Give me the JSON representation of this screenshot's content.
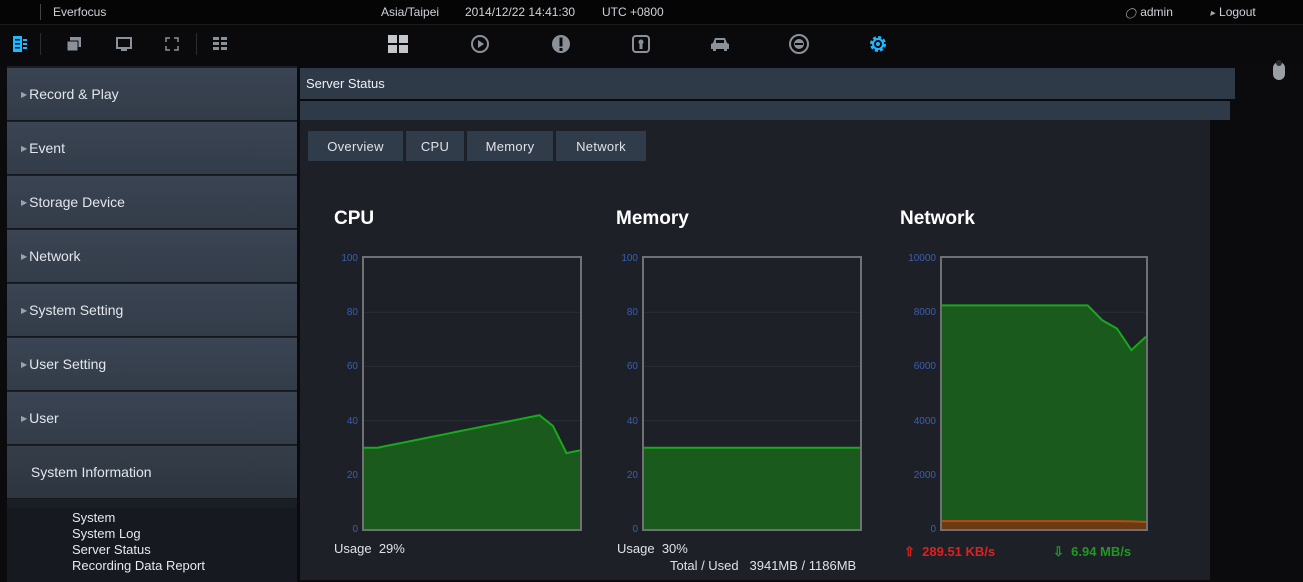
{
  "topbar": {
    "app_name": "Everfocus",
    "timezone": "Asia/Taipei",
    "datetime": "2014/12/22 14:41:30",
    "utc_offset": "UTC +0800",
    "user": "admin",
    "logout_label": "Logout"
  },
  "toolbar": {
    "icons": [
      "live-view-icon",
      "window-icon",
      "monitor-icon",
      "fullscreen-icon",
      "layout-icon",
      "grid-icon",
      "playback-icon",
      "alert-icon",
      "id-card-icon",
      "vehicle-icon",
      "target-icon",
      "settings-icon"
    ],
    "active_color": "#1fb8ff",
    "accent_color": "#1fb8ff"
  },
  "sidebar": {
    "items": [
      {
        "label": "Record & Play"
      },
      {
        "label": "Event"
      },
      {
        "label": "Storage Device"
      },
      {
        "label": "Network"
      },
      {
        "label": "System Setting"
      },
      {
        "label": "User Setting"
      },
      {
        "label": "User"
      },
      {
        "label": "System Information"
      }
    ],
    "submenu": [
      {
        "label": "System"
      },
      {
        "label": "System Log"
      },
      {
        "label": "Server Status"
      },
      {
        "label": "Recording Data Report"
      }
    ]
  },
  "main": {
    "title": "Server Status",
    "tabs": [
      {
        "label": "Overview"
      },
      {
        "label": "CPU"
      },
      {
        "label": "Memory"
      },
      {
        "label": "Network"
      }
    ]
  },
  "chart_data": [
    {
      "type": "area",
      "title": "CPU",
      "ylim": [
        0,
        100
      ],
      "yticks": [
        "100",
        "80",
        "60",
        "40",
        "20",
        "0"
      ],
      "x": [
        0,
        1,
        2,
        3,
        4,
        5,
        6,
        7,
        8,
        9,
        10,
        11,
        12,
        13
      ],
      "series": [
        {
          "values": [
            30,
            30,
            31,
            32,
            33,
            34,
            35,
            36,
            37,
            38,
            39,
            40,
            41,
            42
          ]
        }
      ],
      "tail_values": [
        38,
        28,
        29
      ],
      "usage_label": "Usage",
      "usage_value": "29%",
      "fill_color": "#1a5a1c",
      "line_color": "#1aa81c"
    },
    {
      "type": "area",
      "title": "Memory",
      "ylim": [
        0,
        100
      ],
      "yticks": [
        "100",
        "80",
        "60",
        "40",
        "20",
        "0"
      ],
      "x": [
        0,
        1,
        2,
        3,
        4,
        5,
        6,
        7,
        8,
        9,
        10,
        11,
        12,
        13
      ],
      "series": [
        {
          "values": [
            30,
            30,
            30,
            30,
            30,
            30,
            30,
            30,
            30,
            30,
            30,
            30,
            30,
            30
          ]
        }
      ],
      "usage_label": "Usage",
      "usage_value": "30%",
      "total_used_label": "Total / Used",
      "total_used_value": "3941MB / 1186MB",
      "fill_color": "#1a5a1c",
      "line_color": "#1aa81c"
    },
    {
      "type": "area",
      "title": "Network",
      "ylim": [
        0,
        10000
      ],
      "yticks": [
        "10000",
        "8000",
        "6000",
        "4000",
        "2000",
        "0"
      ],
      "x": [
        0,
        1,
        2,
        3,
        4,
        5,
        6,
        7,
        8,
        9,
        10,
        11,
        12,
        13
      ],
      "series": [
        {
          "values": [
            8250,
            8250,
            8250,
            8250,
            8250,
            8250,
            8250,
            8250,
            8250,
            8250,
            8250,
            7700,
            7400,
            6600,
            7100
          ]
        },
        {
          "values": [
            290,
            290,
            290,
            290,
            290,
            290,
            290,
            290,
            290,
            290,
            290,
            290,
            290,
            280,
            260
          ]
        }
      ],
      "upload_value": "289.51 KB/s",
      "download_value": "6.94 MB/s",
      "down_fill": "#1a5a1c",
      "down_line": "#1aa81c",
      "up_fill": "#6a3a12",
      "up_line": "#b84a12"
    }
  ]
}
